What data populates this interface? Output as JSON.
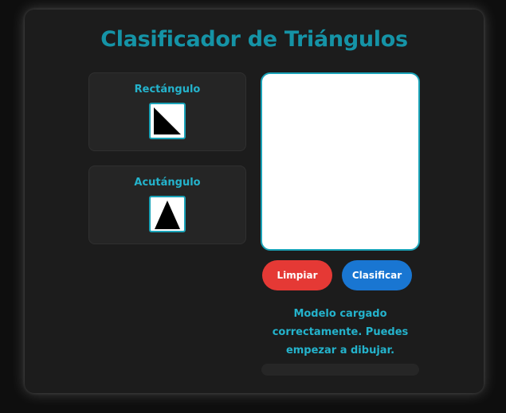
{
  "app": {
    "title": "Clasificador de Triángulos"
  },
  "classes": [
    {
      "label": "Rectángulo",
      "icon": "right-triangle-icon"
    },
    {
      "label": "Acutángulo",
      "icon": "acute-triangle-icon"
    }
  ],
  "canvas": {
    "background": "#ffffff",
    "border_color": "#1aa3b8"
  },
  "buttons": {
    "clear_label": "Limpiar",
    "classify_label": "Clasificar"
  },
  "status": {
    "message": "Modelo cargado correctamente. Puedes empezar a dibujar."
  },
  "progress": {
    "value": 0
  },
  "colors": {
    "accent": "#1593a6",
    "label": "#24b3cc",
    "clear_button": "#e53935",
    "classify_button": "#1976d2"
  }
}
